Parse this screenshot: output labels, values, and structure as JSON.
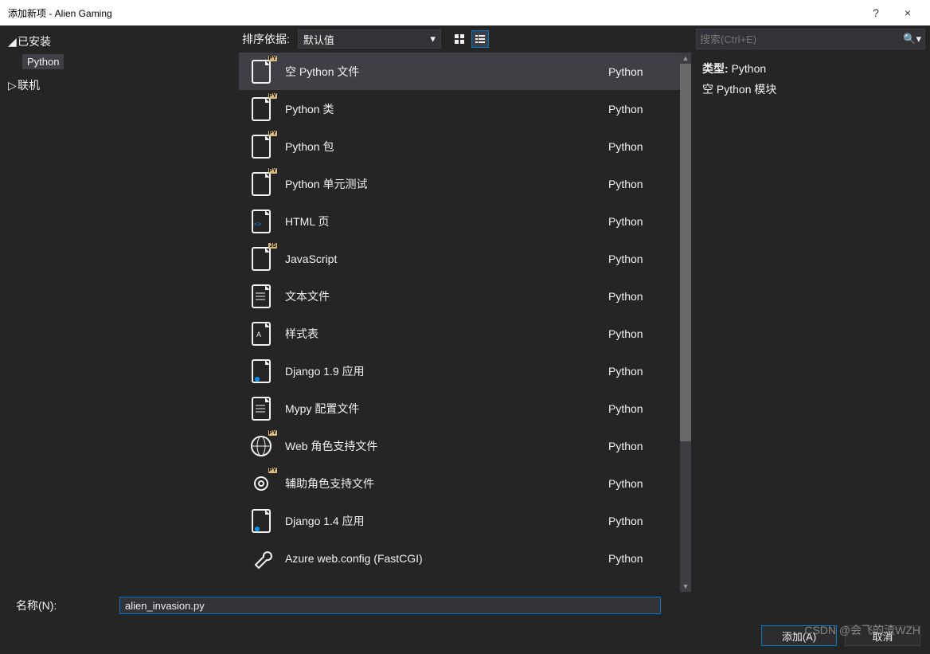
{
  "window": {
    "title": "添加新项 - Alien Gaming",
    "help": "?",
    "close": "×"
  },
  "sidebar": {
    "installed": "已安装",
    "python": "Python",
    "online": "联机"
  },
  "toolbar": {
    "sort_label": "排序依据:",
    "sort_value": "默认值"
  },
  "search": {
    "placeholder": "搜索(Ctrl+E)"
  },
  "right_panel": {
    "type_label": "类型:",
    "type_value": "Python",
    "desc": "空 Python 模块"
  },
  "templates": [
    {
      "name": "空 Python 文件",
      "group": "Python",
      "icon": "py-file",
      "selected": true
    },
    {
      "name": "Python 类",
      "group": "Python",
      "icon": "py-file"
    },
    {
      "name": "Python 包",
      "group": "Python",
      "icon": "py-file"
    },
    {
      "name": "Python 单元测试",
      "group": "Python",
      "icon": "py-file"
    },
    {
      "name": "HTML 页",
      "group": "Python",
      "icon": "html"
    },
    {
      "name": "JavaScript",
      "group": "Python",
      "icon": "js"
    },
    {
      "name": "文本文件",
      "group": "Python",
      "icon": "txt"
    },
    {
      "name": "样式表",
      "group": "Python",
      "icon": "css"
    },
    {
      "name": "Django 1.9 应用",
      "group": "Python",
      "icon": "django"
    },
    {
      "name": "Mypy 配置文件",
      "group": "Python",
      "icon": "cfg"
    },
    {
      "name": "Web 角色支持文件",
      "group": "Python",
      "icon": "web"
    },
    {
      "name": "辅助角色支持文件",
      "group": "Python",
      "icon": "gear"
    },
    {
      "name": "Django 1.4 应用",
      "group": "Python",
      "icon": "django"
    },
    {
      "name": "Azure web.config (FastCGI)",
      "group": "Python",
      "icon": "wrench"
    }
  ],
  "bottom": {
    "name_label": "名称(N):",
    "name_value": "alien_invasion.py",
    "add": "添加(A)",
    "cancel": "取消"
  },
  "watermark": "CSDN @会飞的渣WZH"
}
